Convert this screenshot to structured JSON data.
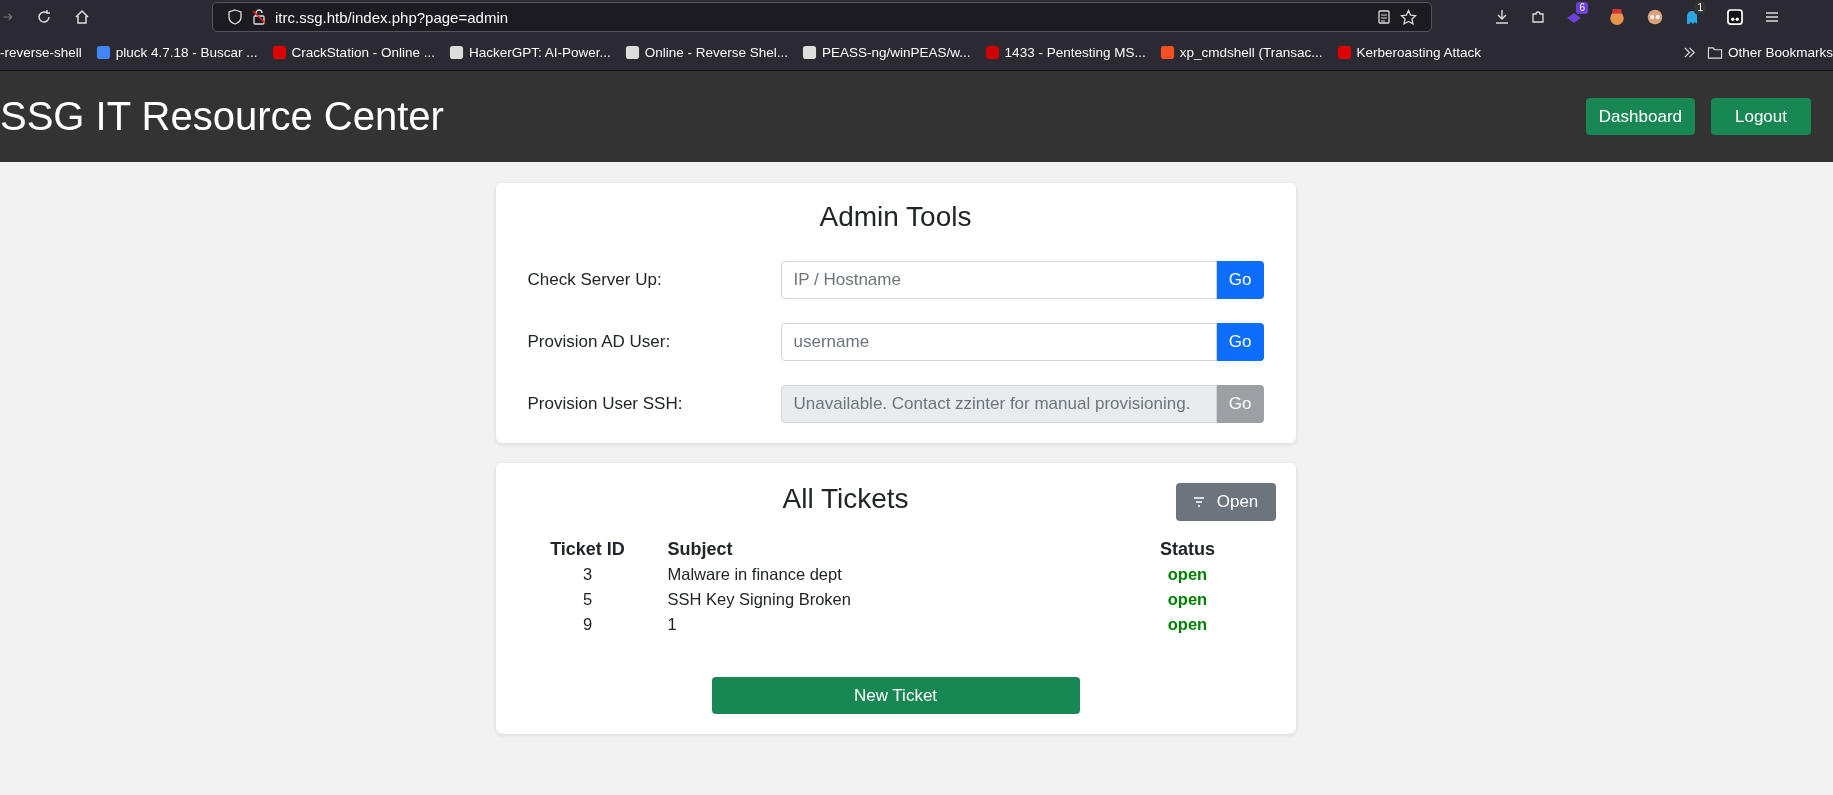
{
  "browser": {
    "url": "itrc.ssg.htb/index.php?page=admin",
    "badges": [
      "6",
      "1"
    ],
    "bookmarks": [
      {
        "label": "-reverse-shell"
      },
      {
        "label": "pluck 4.7.18 - Buscar ..."
      },
      {
        "label": "CrackStation - Online ..."
      },
      {
        "label": "HackerGPT: AI-Power..."
      },
      {
        "label": "Online - Reverse Shel..."
      },
      {
        "label": "PEASS-ng/winPEAS/w..."
      },
      {
        "label": "1433 - Pentesting MS..."
      },
      {
        "label": "xp_cmdshell (Transac..."
      },
      {
        "label": "Kerberoasting Attack"
      }
    ],
    "other_bookmarks": "Other Bookmarks"
  },
  "header": {
    "title": "SSG IT Resource Center",
    "buttons": [
      "Dashboard",
      "Logout"
    ]
  },
  "admin_tools": {
    "title": "Admin Tools",
    "rows": [
      {
        "label": "Check Server Up:",
        "placeholder": "IP / Hostname",
        "button": "Go",
        "disabled": false
      },
      {
        "label": "Provision AD User:",
        "placeholder": "username",
        "button": "Go",
        "disabled": false
      },
      {
        "label": "Provision User SSH:",
        "placeholder": "Unavailable. Contact zzinter for manual provisioning.",
        "button": "Go",
        "disabled": true
      }
    ]
  },
  "tickets": {
    "title": "All Tickets",
    "filter_button": "Open",
    "columns": [
      "Ticket ID",
      "Subject",
      "Status"
    ],
    "rows": [
      {
        "id": "3",
        "subject": "Malware in finance dept",
        "status": "open"
      },
      {
        "id": "5",
        "subject": "SSH Key Signing Broken",
        "status": "open"
      },
      {
        "id": "9",
        "subject": "1",
        "status": "open"
      }
    ],
    "new_ticket_button": "New Ticket"
  }
}
